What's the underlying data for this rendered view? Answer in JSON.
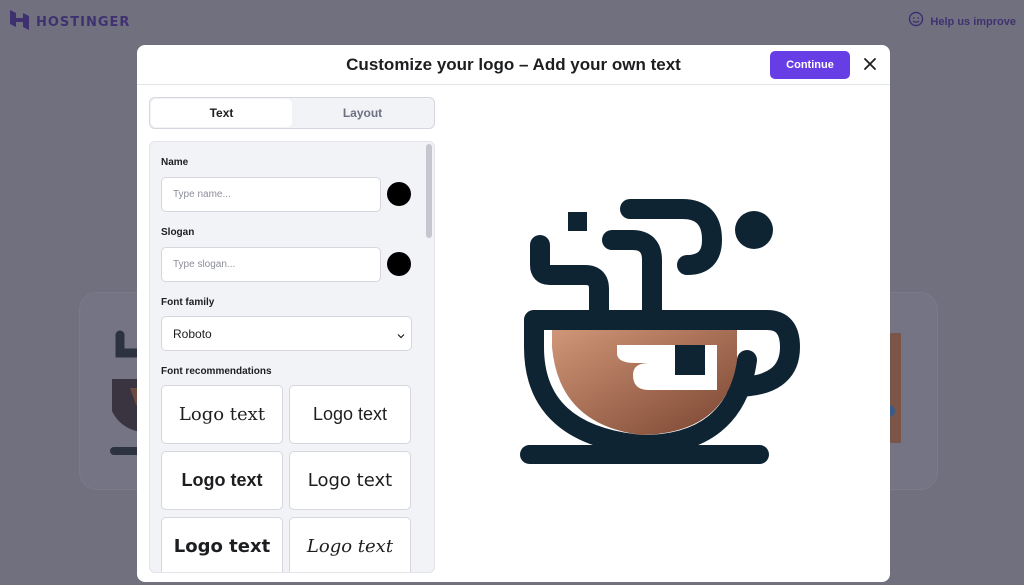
{
  "brand": {
    "name": "HOSTINGER",
    "logo_icon": "hostinger-h-icon"
  },
  "help": {
    "label": "Help us improve",
    "icon": "smiley-plus-icon"
  },
  "modal": {
    "title": "Customize your logo – Add your own text",
    "continue_label": "Continue",
    "close_icon": "close-icon"
  },
  "tabs": [
    {
      "label": "Text",
      "active": true
    },
    {
      "label": "Layout",
      "active": false
    }
  ],
  "form": {
    "name_label": "Name",
    "name_placeholder": "Type name...",
    "name_color": "#000000",
    "slogan_label": "Slogan",
    "slogan_placeholder": "Type slogan...",
    "slogan_color": "#000000",
    "font_family_label": "Font family",
    "font_family_value": "Roboto",
    "font_rec_label": "Font recommendations",
    "font_recommendations": [
      "Logo text",
      "Logo text",
      "Logo text",
      "Logo text",
      "Logo text",
      "Logo text"
    ]
  },
  "colors": {
    "accent": "#673de6",
    "logo_dark": "#0f2433",
    "coffee_light": "#c58a68",
    "coffee_dark": "#8a4e34"
  }
}
